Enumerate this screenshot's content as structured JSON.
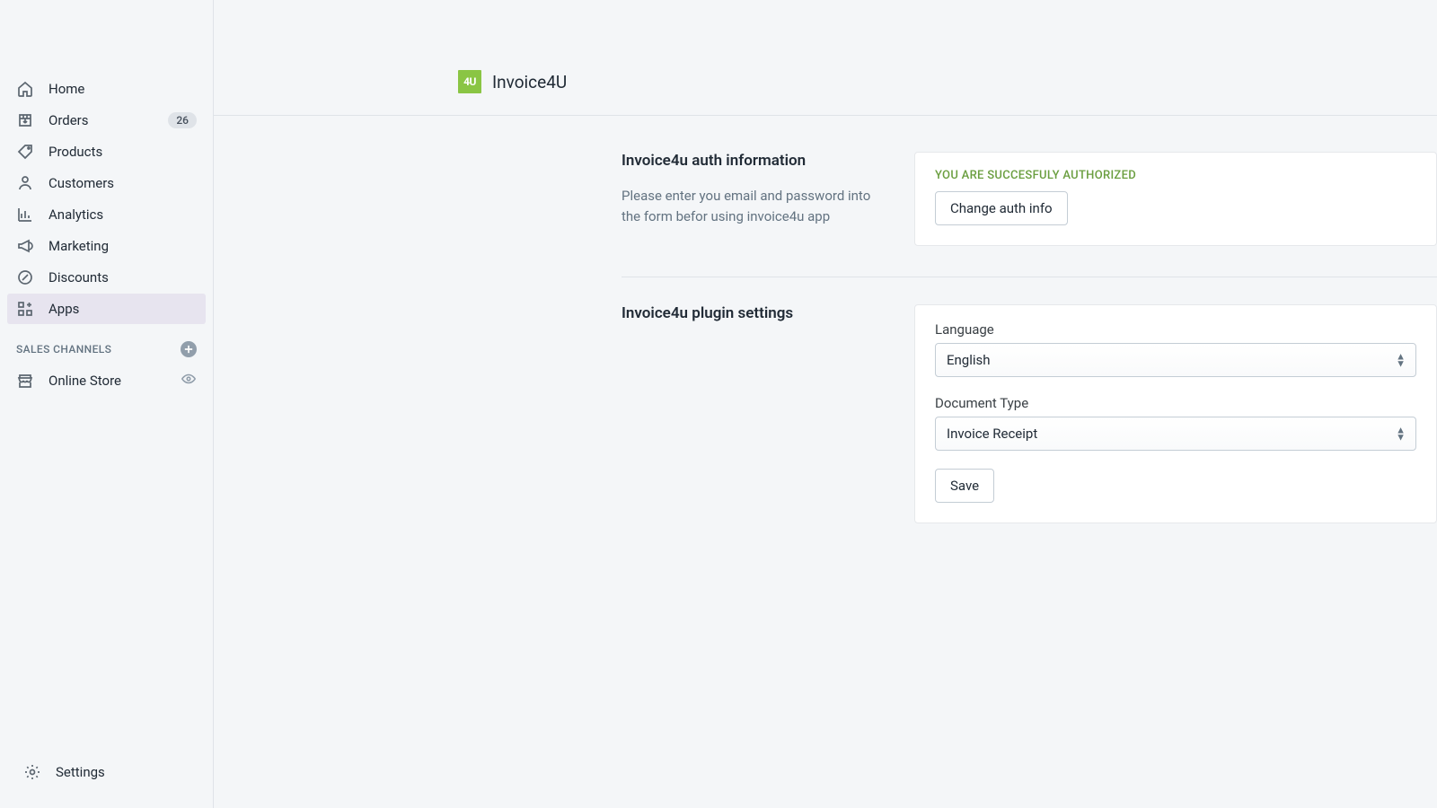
{
  "sidebar": {
    "nav": [
      {
        "label": "Home",
        "icon": "home",
        "badge": null,
        "active": false
      },
      {
        "label": "Orders",
        "icon": "orders",
        "badge": "26",
        "active": false
      },
      {
        "label": "Products",
        "icon": "products",
        "badge": null,
        "active": false
      },
      {
        "label": "Customers",
        "icon": "customers",
        "badge": null,
        "active": false
      },
      {
        "label": "Analytics",
        "icon": "analytics",
        "badge": null,
        "active": false
      },
      {
        "label": "Marketing",
        "icon": "marketing",
        "badge": null,
        "active": false
      },
      {
        "label": "Discounts",
        "icon": "discounts",
        "badge": null,
        "active": false
      },
      {
        "label": "Apps",
        "icon": "apps",
        "badge": null,
        "active": true
      }
    ],
    "channels_header": "SALES CHANNELS",
    "channels": [
      {
        "label": "Online Store",
        "icon": "store"
      }
    ],
    "settings_label": "Settings"
  },
  "header": {
    "logo_text": "4U",
    "app_name": "Invoice4U"
  },
  "auth_section": {
    "title": "Invoice4u auth information",
    "description": "Please enter you email and password into the form befor using invoice4u app",
    "status": "YOU ARE SUCCESFULY AUTHORIZED",
    "button": "Change auth info"
  },
  "settings_section": {
    "title": "Invoice4u plugin settings",
    "language_label": "Language",
    "language_value": "English",
    "doctype_label": "Document Type",
    "doctype_value": "Invoice Receipt",
    "save_button": "Save"
  }
}
